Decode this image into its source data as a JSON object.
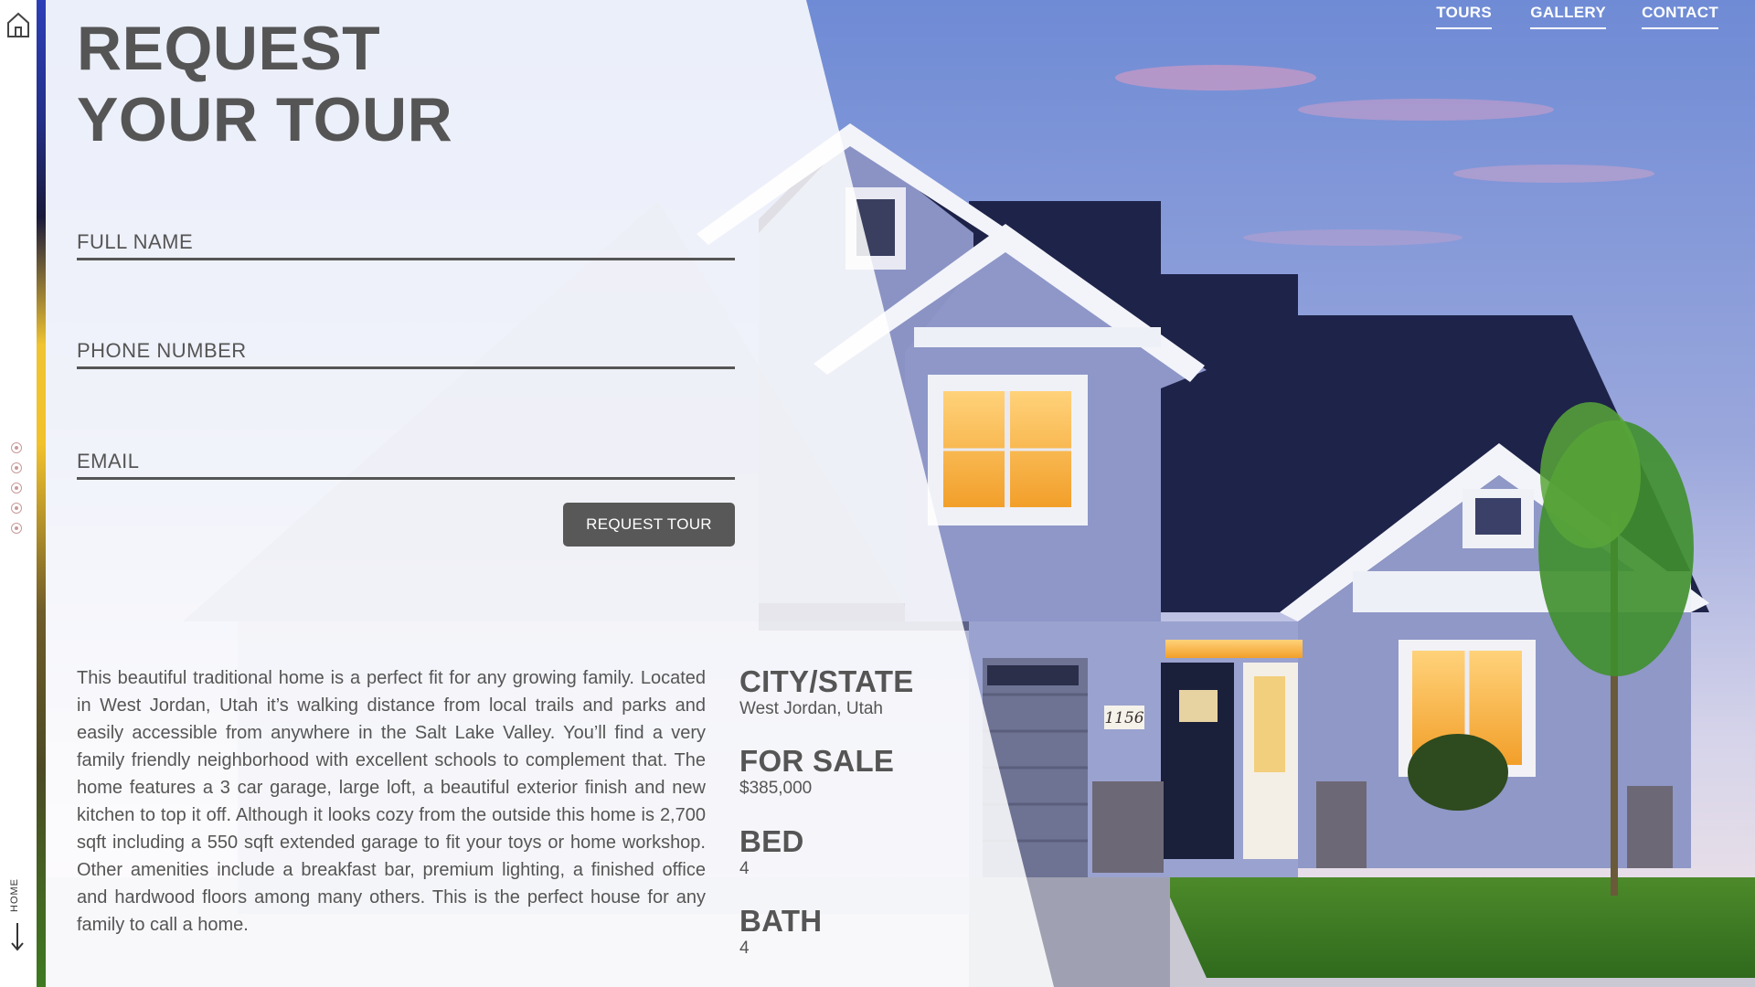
{
  "nav": {
    "items": [
      {
        "label": "TOURS"
      },
      {
        "label": "GALLERY"
      },
      {
        "label": "CONTACT"
      }
    ]
  },
  "sidebar": {
    "home_label": "HOME"
  },
  "hero": {
    "title_line1": "REQUEST",
    "title_line2": "YOUR TOUR"
  },
  "form": {
    "full_name_placeholder": "FULL NAME",
    "phone_placeholder": "PHONE NUMBER",
    "email_placeholder": "EMAIL",
    "submit_label": "REQUEST TOUR"
  },
  "listing": {
    "description": "This beautiful traditional home is a perfect fit for any growing family. Located in West Jordan, Utah it’s walking distance from local trails and parks and easily accessible from anywhere in the Salt Lake Valley. You’ll find a very family friendly neighborhood with excellent schools to complement that. The home features a 3 car garage, large loft, a beautiful exterior finish and new kitchen to top it off. Although it looks cozy from the outside this home is 2,700 sqft including a 550 sqft extended garage to fit your toys or home workshop. Other amenities include a breakfast bar, premium lighting, a finished office and hardwood floors among many others. This is the perfect house for any family to call a home.",
    "facts": [
      {
        "label": "CITY/STATE",
        "value": "West Jordan, Utah"
      },
      {
        "label": "FOR SALE",
        "value": "$385,000"
      },
      {
        "label": "BED",
        "value": "4"
      },
      {
        "label": "BATH",
        "value": "4"
      }
    ],
    "house_number": "1156"
  },
  "colors": {
    "text": "#555555",
    "button": "#585858",
    "sky_top": "#6f8fd6",
    "roof": "#1c2147",
    "siding": "#8c95c4",
    "window_glow": "#f4a93a"
  }
}
